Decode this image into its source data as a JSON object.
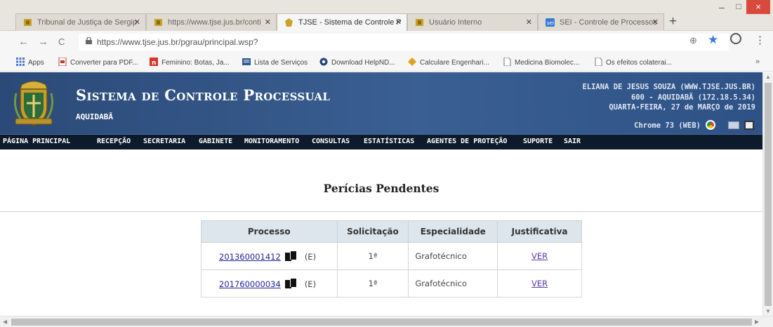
{
  "browser": {
    "tabs": [
      {
        "title": "Tribunal de Justiça de Sergip",
        "active": false
      },
      {
        "title": "https://www.tjse.jus.br/conti",
        "active": false
      },
      {
        "title": "TJSE - Sistema de Controle P",
        "active": true
      },
      {
        "title": "Usuário Interno",
        "active": false
      },
      {
        "title": "SEI - Controle de Processos",
        "active": false
      }
    ],
    "window_controls": {
      "minimize": "–",
      "maximize": "□",
      "close": "×"
    },
    "nav": {
      "back": "←",
      "forward": "→",
      "reload": "C"
    },
    "url": "https://www.tjse.jus.br/pgrau/principal.wsp?",
    "bookmarks": [
      {
        "label": "Apps",
        "icon": "apps-grid-icon"
      },
      {
        "label": "Converter para PDF...",
        "icon": "pdf-icon"
      },
      {
        "label": "Feminino: Botas, Ja...",
        "icon": "store-icon"
      },
      {
        "label": "Lista de Serviços",
        "icon": "list-icon"
      },
      {
        "label": "Download HelpND...",
        "icon": "download-icon"
      },
      {
        "label": "Calculare Engenhari...",
        "icon": "calc-icon"
      },
      {
        "label": "Medicina Biomolec...",
        "icon": "page-icon"
      },
      {
        "label": "Os efeitos colaterai...",
        "icon": "page-icon"
      }
    ],
    "bookmarks_more": "»"
  },
  "header": {
    "system_title": "Sistema de Controle Processual",
    "comarca": "AQUIDABÃ",
    "user_name": "ELIANA DE JESUS SOUZA (WWW.TJSE.JUS.BR)",
    "unit": "600 - AQUIDABÃ (172.18.5.34)",
    "date": "QUARTA-FEIRA, 27 de MARÇO de 2019",
    "browser_info": "Chrome 73 (WEB)"
  },
  "menu": [
    "PÁGINA PRINCIPAL",
    "RECEPÇÃO",
    "SECRETARIA",
    "GABINETE",
    "MONITORAMENTO",
    "CONSULTAS",
    "ESTATÍSTICAS",
    "AGENTES DE PROTEÇÃO",
    "SUPORTE",
    "SAIR"
  ],
  "main": {
    "title": "Perícias Pendentes",
    "table": {
      "headers": [
        "Processo",
        "Solicitação",
        "Especialidade",
        "Justificativa"
      ],
      "rows": [
        {
          "processo": "201360001412",
          "flag": "(E)",
          "solicitacao": "1ª",
          "especialidade": "Grafotécnico",
          "justificativa": "VER"
        },
        {
          "processo": "201760000034",
          "flag": "(E)",
          "solicitacao": "1ª",
          "especialidade": "Grafotécnico",
          "justificativa": "VER"
        }
      ]
    }
  },
  "colors": {
    "header_blue": "#34588b",
    "menu_bar": "#0d1a2c",
    "table_header": "#dde6ec",
    "link": "#22229a",
    "close_red": "#d94a3e"
  }
}
